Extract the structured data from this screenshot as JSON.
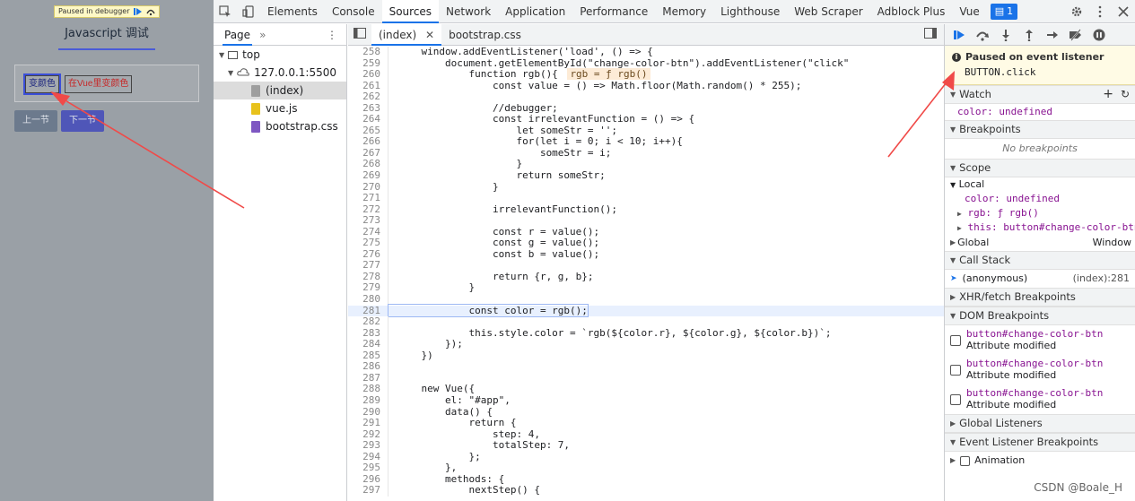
{
  "page": {
    "paused_banner": "Paused in debugger",
    "title": "Javascript 调试",
    "btn_change": "变颜色",
    "btn_vue": "在Vue里变颜色",
    "btn_prev": "上一节",
    "btn_next": "下一节"
  },
  "devtools": {
    "tabs": [
      "Elements",
      "Console",
      "Sources",
      "Network",
      "Application",
      "Performance",
      "Memory",
      "Lighthouse",
      "Web Scraper",
      "Adblock Plus",
      "Vue"
    ],
    "active_tab": "Sources",
    "issues_count": "1",
    "navigator": {
      "tab": "Page",
      "top": "top",
      "host": "127.0.0.1:5500",
      "files": [
        "(index)",
        "vue.js",
        "bootstrap.css"
      ]
    },
    "editor_tabs": [
      "(index)",
      "bootstrap.css"
    ],
    "code_lines": [
      {
        "n": "258",
        "t": "    window.addEventListener('load', () => {"
      },
      {
        "n": "259",
        "t": "        document.getElementById(\"change-color-btn\").addEventListener(\"click\""
      },
      {
        "n": "260",
        "t": "            function rgb(){ ",
        "inline": "rgb = ƒ rgb()"
      },
      {
        "n": "261",
        "t": "                const value = () => Math.floor(Math.random() * 255);"
      },
      {
        "n": "262",
        "t": ""
      },
      {
        "n": "263",
        "t": "                //debugger;"
      },
      {
        "n": "264",
        "t": "                const irrelevantFunction = () => {"
      },
      {
        "n": "265",
        "t": "                    let someStr = '';"
      },
      {
        "n": "266",
        "t": "                    for(let i = 0; i < 10; i++){"
      },
      {
        "n": "267",
        "t": "                        someStr = i;"
      },
      {
        "n": "268",
        "t": "                    }"
      },
      {
        "n": "269",
        "t": "                    return someStr;"
      },
      {
        "n": "270",
        "t": "                }"
      },
      {
        "n": "271",
        "t": ""
      },
      {
        "n": "272",
        "t": "                irrelevantFunction();"
      },
      {
        "n": "273",
        "t": ""
      },
      {
        "n": "274",
        "t": "                const r = value();"
      },
      {
        "n": "275",
        "t": "                const g = value();"
      },
      {
        "n": "276",
        "t": "                const b = value();"
      },
      {
        "n": "277",
        "t": ""
      },
      {
        "n": "278",
        "t": "                return {r, g, b};"
      },
      {
        "n": "279",
        "t": "            }"
      },
      {
        "n": "280",
        "t": ""
      },
      {
        "n": "281",
        "t": "            const color = rgb();",
        "highlight": true
      },
      {
        "n": "282",
        "t": ""
      },
      {
        "n": "283",
        "t": "            this.style.color = `rgb(${color.r}, ${color.g}, ${color.b})`;"
      },
      {
        "n": "284",
        "t": "        });"
      },
      {
        "n": "285",
        "t": "    })"
      },
      {
        "n": "286",
        "t": ""
      },
      {
        "n": "287",
        "t": ""
      },
      {
        "n": "288",
        "t": "    new Vue({"
      },
      {
        "n": "289",
        "t": "        el: \"#app\","
      },
      {
        "n": "290",
        "t": "        data() {"
      },
      {
        "n": "291",
        "t": "            return {"
      },
      {
        "n": "292",
        "t": "                step: 4,"
      },
      {
        "n": "293",
        "t": "                totalStep: 7,"
      },
      {
        "n": "294",
        "t": "            };"
      },
      {
        "n": "295",
        "t": "        },"
      },
      {
        "n": "296",
        "t": "        methods: {"
      },
      {
        "n": "297",
        "t": "            nextStep() {"
      }
    ],
    "debugger": {
      "paused_title": "Paused on event listener",
      "paused_event": "BUTTON.click",
      "watch_title": "Watch",
      "watch_expr": "color: undefined",
      "breakpoints_title": "Breakpoints",
      "no_breakpoints": "No breakpoints",
      "scope_title": "Scope",
      "scope_local": "Local",
      "scope_color": "color: undefined",
      "scope_rgb": "rgb: ƒ rgb()",
      "scope_this": "this: button#change-color-btn",
      "scope_global": "Global",
      "scope_global_val": "Window",
      "callstack_title": "Call Stack",
      "callstack_fn": "(anonymous)",
      "callstack_loc": "(index):281",
      "xhr_title": "XHR/fetch Breakpoints",
      "dom_title": "DOM Breakpoints",
      "dom_items": [
        {
          "sel": "button#change-color-btn",
          "type": "Attribute modified"
        },
        {
          "sel": "button#change-color-btn",
          "type": "Attribute modified"
        },
        {
          "sel": "button#change-color-btn",
          "type": "Attribute modified"
        }
      ],
      "global_listeners_title": "Global Listeners",
      "event_bp_title": "Event Listener Breakpoints",
      "event_bp_animation": "Animation"
    }
  },
  "watermark": "CSDN @Boale_H",
  "colors": {
    "accent": "#1a73e8",
    "arrow": "#f04a48",
    "pause_bg": "#fffbe5",
    "highlight": "#e8f0fe"
  }
}
